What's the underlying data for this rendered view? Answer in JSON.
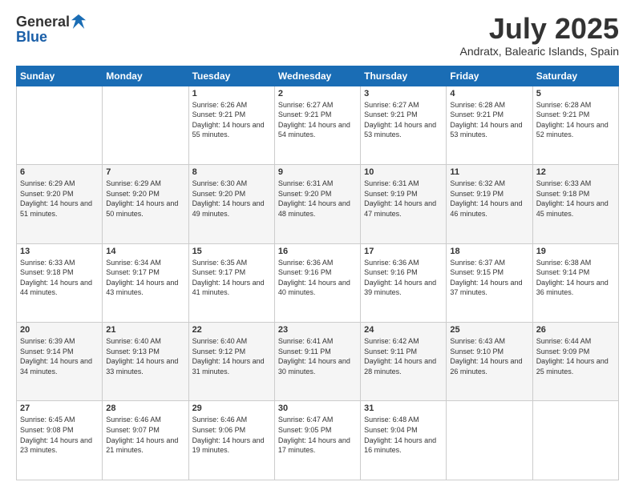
{
  "header": {
    "logo_line1": "General",
    "logo_line2": "Blue",
    "month_title": "July 2025",
    "location": "Andratx, Balearic Islands, Spain"
  },
  "weekdays": [
    "Sunday",
    "Monday",
    "Tuesday",
    "Wednesday",
    "Thursday",
    "Friday",
    "Saturday"
  ],
  "weeks": [
    [
      {
        "day": "",
        "info": ""
      },
      {
        "day": "",
        "info": ""
      },
      {
        "day": "1",
        "info": "Sunrise: 6:26 AM\nSunset: 9:21 PM\nDaylight: 14 hours and 55 minutes."
      },
      {
        "day": "2",
        "info": "Sunrise: 6:27 AM\nSunset: 9:21 PM\nDaylight: 14 hours and 54 minutes."
      },
      {
        "day": "3",
        "info": "Sunrise: 6:27 AM\nSunset: 9:21 PM\nDaylight: 14 hours and 53 minutes."
      },
      {
        "day": "4",
        "info": "Sunrise: 6:28 AM\nSunset: 9:21 PM\nDaylight: 14 hours and 53 minutes."
      },
      {
        "day": "5",
        "info": "Sunrise: 6:28 AM\nSunset: 9:21 PM\nDaylight: 14 hours and 52 minutes."
      }
    ],
    [
      {
        "day": "6",
        "info": "Sunrise: 6:29 AM\nSunset: 9:20 PM\nDaylight: 14 hours and 51 minutes."
      },
      {
        "day": "7",
        "info": "Sunrise: 6:29 AM\nSunset: 9:20 PM\nDaylight: 14 hours and 50 minutes."
      },
      {
        "day": "8",
        "info": "Sunrise: 6:30 AM\nSunset: 9:20 PM\nDaylight: 14 hours and 49 minutes."
      },
      {
        "day": "9",
        "info": "Sunrise: 6:31 AM\nSunset: 9:20 PM\nDaylight: 14 hours and 48 minutes."
      },
      {
        "day": "10",
        "info": "Sunrise: 6:31 AM\nSunset: 9:19 PM\nDaylight: 14 hours and 47 minutes."
      },
      {
        "day": "11",
        "info": "Sunrise: 6:32 AM\nSunset: 9:19 PM\nDaylight: 14 hours and 46 minutes."
      },
      {
        "day": "12",
        "info": "Sunrise: 6:33 AM\nSunset: 9:18 PM\nDaylight: 14 hours and 45 minutes."
      }
    ],
    [
      {
        "day": "13",
        "info": "Sunrise: 6:33 AM\nSunset: 9:18 PM\nDaylight: 14 hours and 44 minutes."
      },
      {
        "day": "14",
        "info": "Sunrise: 6:34 AM\nSunset: 9:17 PM\nDaylight: 14 hours and 43 minutes."
      },
      {
        "day": "15",
        "info": "Sunrise: 6:35 AM\nSunset: 9:17 PM\nDaylight: 14 hours and 41 minutes."
      },
      {
        "day": "16",
        "info": "Sunrise: 6:36 AM\nSunset: 9:16 PM\nDaylight: 14 hours and 40 minutes."
      },
      {
        "day": "17",
        "info": "Sunrise: 6:36 AM\nSunset: 9:16 PM\nDaylight: 14 hours and 39 minutes."
      },
      {
        "day": "18",
        "info": "Sunrise: 6:37 AM\nSunset: 9:15 PM\nDaylight: 14 hours and 37 minutes."
      },
      {
        "day": "19",
        "info": "Sunrise: 6:38 AM\nSunset: 9:14 PM\nDaylight: 14 hours and 36 minutes."
      }
    ],
    [
      {
        "day": "20",
        "info": "Sunrise: 6:39 AM\nSunset: 9:14 PM\nDaylight: 14 hours and 34 minutes."
      },
      {
        "day": "21",
        "info": "Sunrise: 6:40 AM\nSunset: 9:13 PM\nDaylight: 14 hours and 33 minutes."
      },
      {
        "day": "22",
        "info": "Sunrise: 6:40 AM\nSunset: 9:12 PM\nDaylight: 14 hours and 31 minutes."
      },
      {
        "day": "23",
        "info": "Sunrise: 6:41 AM\nSunset: 9:11 PM\nDaylight: 14 hours and 30 minutes."
      },
      {
        "day": "24",
        "info": "Sunrise: 6:42 AM\nSunset: 9:11 PM\nDaylight: 14 hours and 28 minutes."
      },
      {
        "day": "25",
        "info": "Sunrise: 6:43 AM\nSunset: 9:10 PM\nDaylight: 14 hours and 26 minutes."
      },
      {
        "day": "26",
        "info": "Sunrise: 6:44 AM\nSunset: 9:09 PM\nDaylight: 14 hours and 25 minutes."
      }
    ],
    [
      {
        "day": "27",
        "info": "Sunrise: 6:45 AM\nSunset: 9:08 PM\nDaylight: 14 hours and 23 minutes."
      },
      {
        "day": "28",
        "info": "Sunrise: 6:46 AM\nSunset: 9:07 PM\nDaylight: 14 hours and 21 minutes."
      },
      {
        "day": "29",
        "info": "Sunrise: 6:46 AM\nSunset: 9:06 PM\nDaylight: 14 hours and 19 minutes."
      },
      {
        "day": "30",
        "info": "Sunrise: 6:47 AM\nSunset: 9:05 PM\nDaylight: 14 hours and 17 minutes."
      },
      {
        "day": "31",
        "info": "Sunrise: 6:48 AM\nSunset: 9:04 PM\nDaylight: 14 hours and 16 minutes."
      },
      {
        "day": "",
        "info": ""
      },
      {
        "day": "",
        "info": ""
      }
    ]
  ]
}
